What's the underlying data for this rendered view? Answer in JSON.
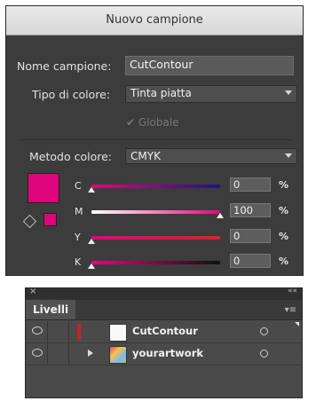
{
  "dialog": {
    "title": "Nuovo campione",
    "name_label": "Nome campione:",
    "name_value": "CutContour",
    "color_type_label": "Tipo di colore:",
    "color_type_value": "Tinta piatta",
    "global_label": "Globale",
    "global_checked": true,
    "global_disabled": true,
    "color_mode_label": "Metodo colore:",
    "color_mode_value": "CMYK",
    "swatch_color": "#e0057b",
    "channels": [
      {
        "label": "C",
        "value": "0",
        "unit": "%",
        "level": 0
      },
      {
        "label": "M",
        "value": "100",
        "unit": "%",
        "level": 100
      },
      {
        "label": "Y",
        "value": "0",
        "unit": "%",
        "level": 0
      },
      {
        "label": "K",
        "value": "0",
        "unit": "%",
        "level": 0
      }
    ]
  },
  "layers_panel": {
    "close_icon": "×",
    "collapse_icon": "««",
    "tab_label": "Livelli",
    "menu_icon": "▾≡",
    "layers": [
      {
        "name": "CutContour",
        "visible": true,
        "color": "#cc2020",
        "expandable": false
      },
      {
        "name": "yourartwork",
        "visible": true,
        "color": "#cc2020",
        "expandable": true
      }
    ]
  }
}
